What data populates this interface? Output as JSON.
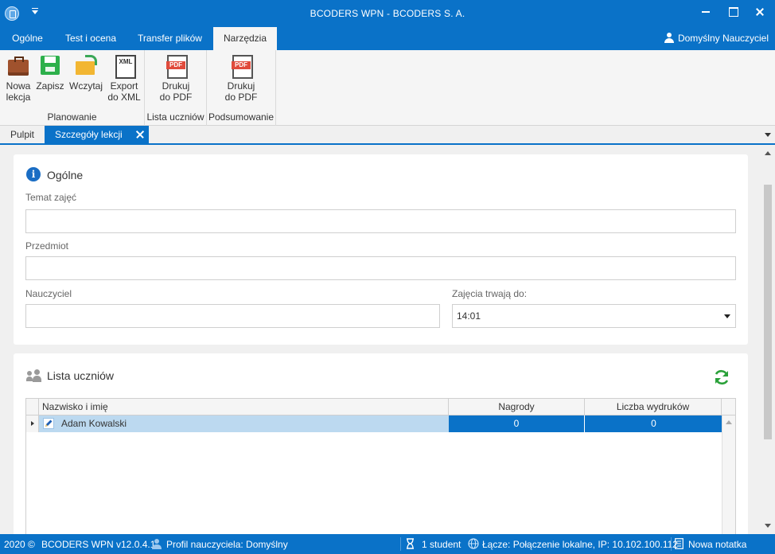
{
  "window": {
    "title": "BCODERS WPN - BCODERS S. A."
  },
  "ribbon_tabs": [
    {
      "label": "Ogólne"
    },
    {
      "label": "Test i ocena"
    },
    {
      "label": "Transfer plików"
    },
    {
      "label": "Narzędzia",
      "active": true
    }
  ],
  "user": {
    "label": "Domyślny Nauczyciel"
  },
  "ribbon": {
    "groups": [
      {
        "label": "Planowanie",
        "buttons": [
          {
            "line1": "Nowa",
            "line2": "lekcja",
            "icon": "briefcase-icon"
          },
          {
            "line1": "Zapisz",
            "line2": "",
            "icon": "save-icon"
          },
          {
            "line1": "Wczytaj",
            "line2": "",
            "icon": "folder-open-icon"
          },
          {
            "line1": "Export",
            "line2": "do XML",
            "icon": "xml-file-icon"
          }
        ]
      },
      {
        "label": "Lista uczniów",
        "buttons": [
          {
            "line1": "Drukuj",
            "line2": "do PDF",
            "icon": "pdf-file-icon"
          }
        ]
      },
      {
        "label": "Podsumowanie",
        "buttons": [
          {
            "line1": "Drukuj",
            "line2": "do PDF",
            "icon": "pdf-file-icon"
          }
        ]
      }
    ]
  },
  "doc_tabs": [
    {
      "label": "Pulpit"
    },
    {
      "label": "Szczegóły lekcji",
      "active": true
    }
  ],
  "general": {
    "title": "Ogólne",
    "info_glyph": "i",
    "topic_label": "Temat zajęć",
    "topic_value": "",
    "subject_label": "Przedmiot",
    "subject_value": "",
    "teacher_label": "Nauczyciel",
    "teacher_value": "",
    "end_label": "Zajęcia trwają do:",
    "end_value": "14:01"
  },
  "students": {
    "title": "Lista uczniów",
    "columns": [
      "Nazwisko i imię",
      "Nagrody",
      "Liczba wydruków"
    ],
    "rows": [
      {
        "name": "Adam Kowalski",
        "rewards": "0",
        "prints": "0"
      }
    ]
  },
  "statusbar": {
    "year": "2020 ©",
    "version": "BCODERS WPN v12.0.4.1",
    "profile": "Profil nauczyciela: Domyślny",
    "students_count": "1 student",
    "connection": "Łącze: Połączenie lokalne, IP: 10.102.100.112",
    "note": "Nowa notatka"
  },
  "colors": {
    "accent": "#0a72c8",
    "selection": "#bcd9f0",
    "refresh": "#2aa139",
    "pdf": "#e04b3c"
  }
}
